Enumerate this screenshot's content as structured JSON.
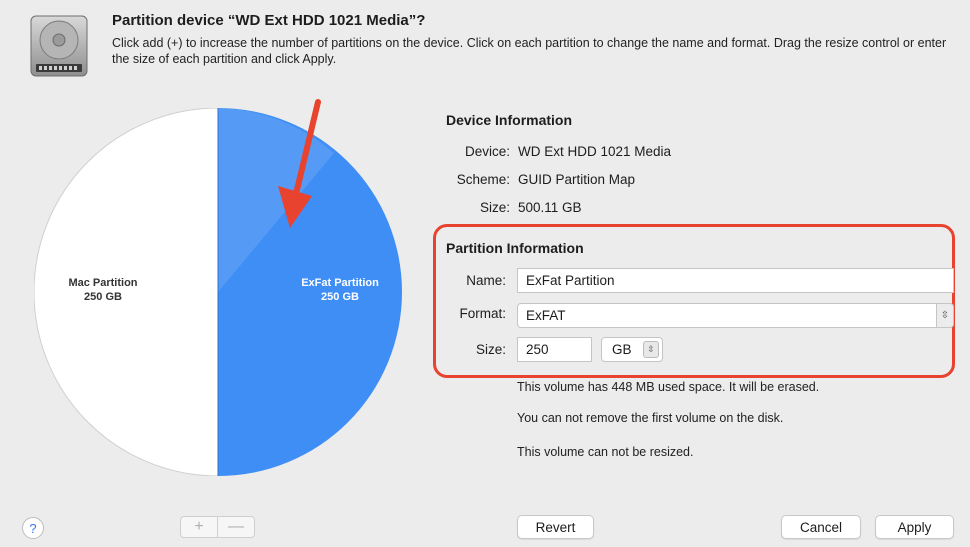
{
  "header": {
    "title": "Partition device “WD Ext HDD 1021 Media”?",
    "description": "Click add (+) to increase the number of partitions on the device. Click on each partition to change the name and format. Drag the resize control or enter the size of each partition and click Apply."
  },
  "pie": {
    "partitions": [
      {
        "name": "Mac Partition",
        "size": "250 GB",
        "color": "#ffffff"
      },
      {
        "name": "ExFat Partition",
        "size": "250 GB",
        "color": "#3e8ef5",
        "selected": true
      }
    ]
  },
  "device_info": {
    "heading": "Device Information",
    "device_label": "Device:",
    "device_value": "WD Ext HDD 1021 Media",
    "scheme_label": "Scheme:",
    "scheme_value": "GUID Partition Map",
    "size_label": "Size:",
    "size_value": "500.11 GB"
  },
  "partition_info": {
    "heading": "Partition Information",
    "name_label": "Name:",
    "name_value": "ExFat Partition",
    "format_label": "Format:",
    "format_value": "ExFAT",
    "size_label": "Size:",
    "size_value": "250",
    "unit_value": "GB",
    "highlight_color": "#e8432f"
  },
  "notes": [
    "This volume has 448 MB used space. It will be erased.",
    "You can not remove the first volume on the disk.",
    "This volume can not be resized."
  ],
  "bottom": {
    "help_label": "?",
    "add_label": "+",
    "remove_label": "—",
    "revert_label": "Revert",
    "cancel_label": "Cancel",
    "apply_label": "Apply"
  },
  "icons": {
    "disk": "hard-drive-icon",
    "arrow": "red-arrow-annotation"
  }
}
